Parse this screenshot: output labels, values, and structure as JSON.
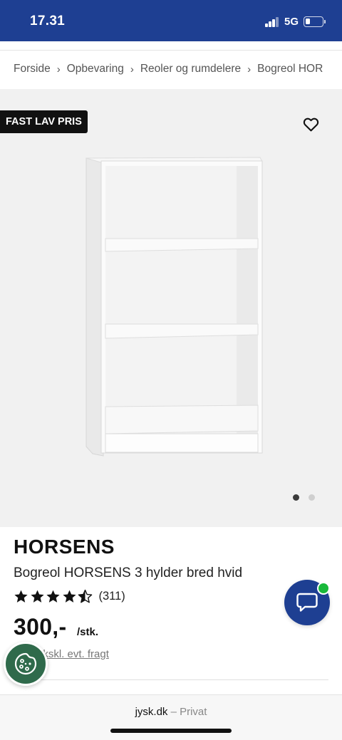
{
  "status_bar": {
    "time": "17.31",
    "network": "5G"
  },
  "breadcrumb": [
    "Forside",
    "Opbevaring",
    "Reoler og rumdelere",
    "Bogreol HOR"
  ],
  "badge": "FAST LAV PRIS",
  "product": {
    "name": "HORSENS",
    "description": "Bogreol HORSENS 3 hylder bred hvid",
    "rating_stars": 4.5,
    "review_count": "(311)",
    "price": "300,-",
    "price_unit": "/stk.",
    "freight": "ekskl. evt. fragt"
  },
  "carousel": {
    "total": 2,
    "active": 1
  },
  "browser": {
    "domain": "jysk.dk",
    "separator": "–",
    "mode": "Privat"
  },
  "colors": {
    "brand_blue": "#1e3f92",
    "online_green": "#19b93a",
    "cookie_green": "#2f6a4b"
  }
}
